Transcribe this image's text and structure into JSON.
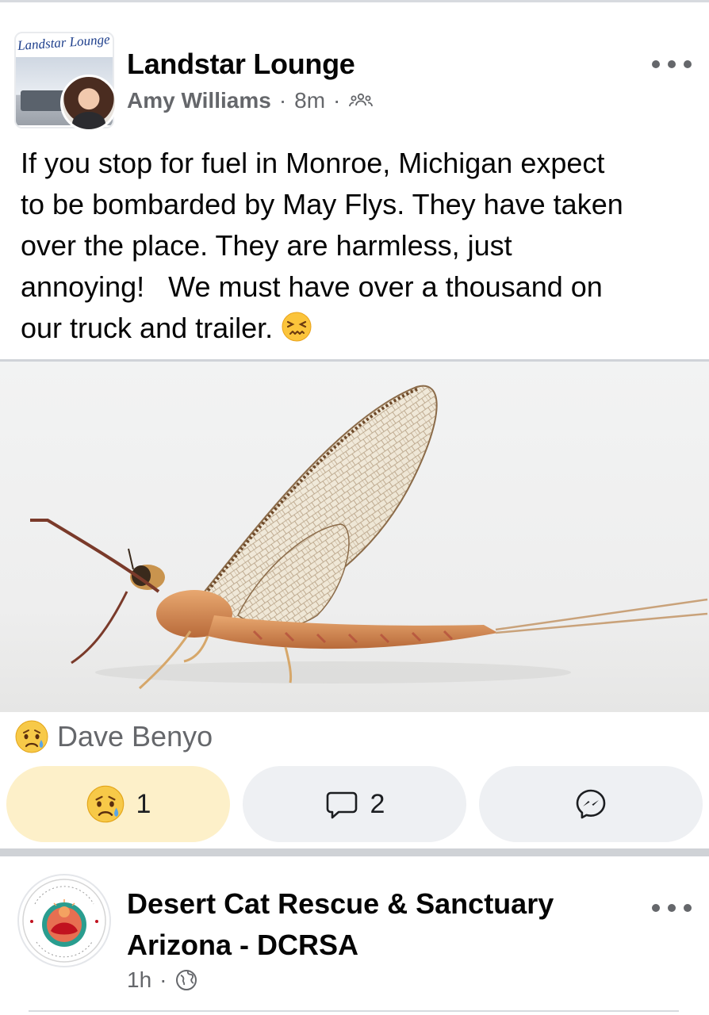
{
  "post1": {
    "group_name": "Landstar Lounge",
    "group_logo_text": "Landstar Lounge",
    "author": "Amy Williams",
    "separator": "·",
    "time": "8m",
    "audience_icon": "members-icon",
    "text_lines": [
      "If you stop for fuel in Monroe, Michigan expect",
      "to be bombarded by May Flys. They have taken",
      "over the place. They are harmless, just",
      "annoying!   We must have over a thousand on",
      "our truck and trailer."
    ],
    "text_emoji": "confounded-face-icon",
    "photo_subject": "mayfly-photo",
    "reactor_name": "Dave Benyo",
    "reaction_icon": "sad-face-icon",
    "reaction_count": "1",
    "comment_count": "2",
    "share_icon": "messenger-icon"
  },
  "post2": {
    "org_name": "Desert Cat Rescue & Sanctuary Arizona - DCRSA",
    "time": "1h",
    "separator": "·",
    "audience_icon": "globe-icon"
  },
  "colors": {
    "secondary_text": "#65676b",
    "active_reaction_bg": "#fdf0c9",
    "pill_bg": "#eef0f3"
  }
}
